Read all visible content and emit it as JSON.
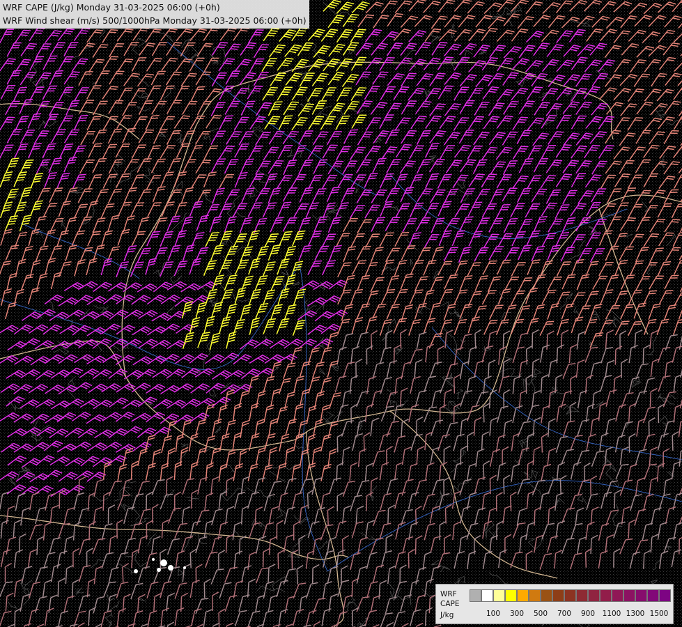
{
  "title": {
    "line1": "WRF CAPE (J/kg) Monday 31-03-2025 06:00 (+0h)",
    "line2": "WRF Wind shear (m/s) 500/1000hPa Monday 31-03-2025 06:00 (+0h)"
  },
  "legend": {
    "label_line1": "WRF",
    "label_line2": "CAPE",
    "label_line3": "J/kg",
    "colors": [
      "#b0b0b0",
      "#ffffff",
      "#ffff99",
      "#ffff00",
      "#ffaa00",
      "#d07a10",
      "#9a5214",
      "#8e3e17",
      "#8c3322",
      "#8e2a33",
      "#902440",
      "#921d4a",
      "#901856",
      "#8c1262",
      "#870d6d",
      "#820878",
      "#7d0483"
    ],
    "ticks": [
      "100",
      "300",
      "500",
      "700",
      "900",
      "1100",
      "1300",
      "1500"
    ]
  },
  "barb_colors": {
    "high": "#ffff33",
    "mid": "#e22ee8",
    "low": "#e48478",
    "faint": "#b06f77",
    "terrain": "#888888",
    "border": "#e8c9a0",
    "river": "#3a6fd8"
  }
}
